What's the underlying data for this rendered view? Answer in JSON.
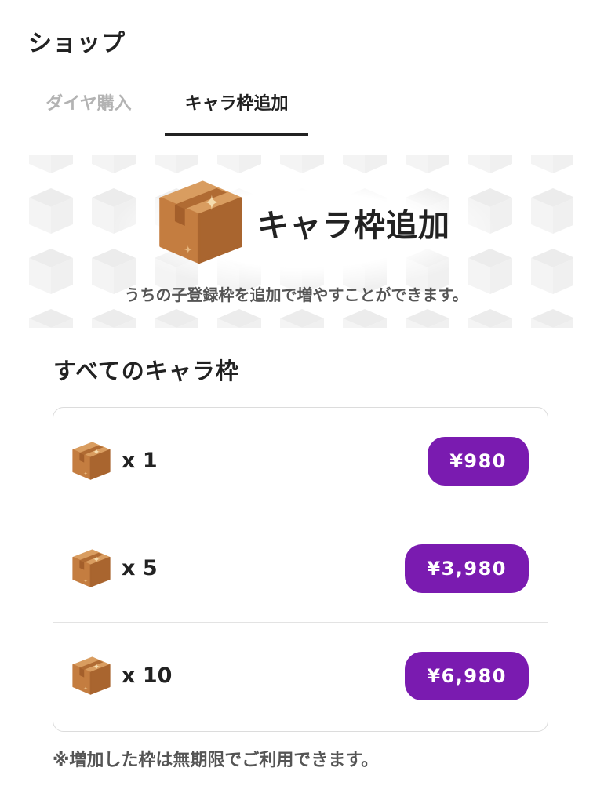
{
  "header": {
    "title": "ショップ"
  },
  "tabs": [
    {
      "label": "ダイヤ購入",
      "active": false
    },
    {
      "label": "キャラ枠追加",
      "active": true
    }
  ],
  "banner": {
    "icon": "cardboard-box-icon",
    "title": "キャラ枠追加",
    "description": "うちの子登録枠を追加で増やすことができます。"
  },
  "section": {
    "title": "すべてのキャラ枠"
  },
  "products": [
    {
      "icon": "cardboard-box-icon",
      "quantity": "x 1",
      "price": "¥980"
    },
    {
      "icon": "cardboard-box-icon",
      "quantity": "x 5",
      "price": "¥3,980"
    },
    {
      "icon": "cardboard-box-icon",
      "quantity": "x 10",
      "price": "¥6,980"
    }
  ],
  "footnote": "※増加した枠は無期限でご利用できます。",
  "colors": {
    "accent": "#7a1bb0",
    "text": "#222222",
    "muted": "#555555",
    "inactive": "#b3b3b3"
  }
}
